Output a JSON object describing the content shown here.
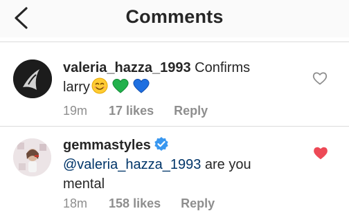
{
  "header": {
    "title": "Comments"
  },
  "comments": [
    {
      "username": "valeria_hazza_1993",
      "text_line1": "Confirms",
      "text_line2": "larry",
      "emojis": [
        "smiling-face-emoji",
        "green-heart-emoji",
        "blue-heart-emoji"
      ],
      "time": "19m",
      "likes": "17 likes",
      "reply": "Reply",
      "liked": false
    },
    {
      "username": "gemmastyles",
      "verified": true,
      "mention": "@valeria_hazza_1993",
      "text_rest": " are you",
      "text_line2": "mental",
      "time": "18m",
      "likes": "158 likes",
      "reply": "Reply",
      "liked": true
    }
  ],
  "colors": {
    "text": "#262626",
    "meta": "#8e8e8e",
    "mention": "#003569",
    "verified_blue": "#3897f0",
    "liked_red": "#ed4956",
    "divider": "#dbdbdb"
  }
}
